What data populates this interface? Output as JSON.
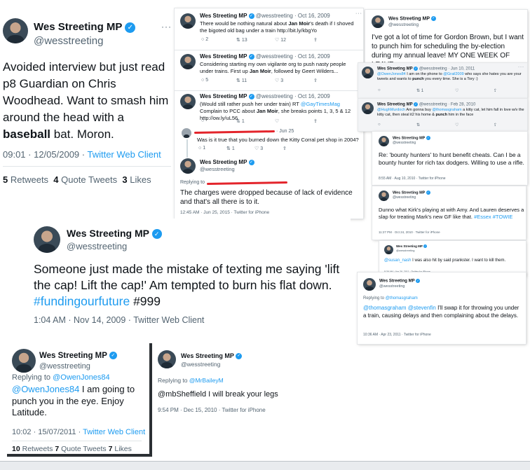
{
  "account": {
    "name": "Wes Streeting MP",
    "handle": "@wesstreeting"
  },
  "t1": {
    "text_a": "Avoided interview but just read p8 Guardian on Chris Woodhead. Want to smash him around the head with a ",
    "text_bold": "baseball",
    "text_b": " bat. Moron.",
    "time": "09:01 · 12/05/2009 · ",
    "client": "Twitter Web Client",
    "stats": [
      {
        "count": "5",
        "label": "Retweets"
      },
      {
        "count": "4",
        "label": "Quote Tweets"
      },
      {
        "count": "3",
        "label": "Likes"
      }
    ]
  },
  "t2": {
    "rows": [
      {
        "date": "· Oct 16, 2009",
        "text_a": "There would be nothing natural about ",
        "bold": "Jan Moir",
        "text_b": "'s death if I shoved the bigoted old bag under a train http://bit.ly/kbgYo",
        "counts": [
          "2",
          "13",
          "12"
        ]
      },
      {
        "date": "· Oct 16, 2009",
        "text_a": "Considering starting my own vigilante org to push nasty people under trains. First up ",
        "bold": "Jan Moir",
        "text_b": ", followed by Geert Wilders...",
        "counts": [
          "5",
          "11",
          "3"
        ]
      },
      {
        "date": "· Oct 16, 2009",
        "text_a": "(Would still rather push her under train) RT ",
        "mention": "@GayTimesMag",
        "text_b": " Complain to PCC about ",
        "bold": "Jan Moir",
        "text_c": ", she breaks points 1, 3, 5 & 12 http://ow.ly/uL56",
        "counts": [
          "",
          "1",
          ""
        ]
      }
    ],
    "reply_parent": {
      "date": "· Jun 25",
      "text": "Was is it true that you burned down the Kitty Corral pet shop in 2004?",
      "counts": [
        "1",
        "1",
        "3"
      ]
    },
    "reply": {
      "replying_to": "Replying to",
      "text": "The charges were dropped because of lack of evidence and that's all there is to it.",
      "time": "12:45 AM · Jun 25, 2015 · Twitter for iPhone"
    }
  },
  "t3": {
    "text": "I've got a lot of time for Gordon Brown, but I want to punch him for scheduling the by-election during my annual leave! MY ONE WEEK OF LEAVE",
    "row1": {
      "date": "· Jun 10, 2011",
      "mention": "@OwenJones84",
      "text_a": " I am on the phone to ",
      "mention2": "@Grail2009",
      "text_b": " who says she hates you are your tweets and wants to ",
      "bold": "punch",
      "text_c": " you every time. She is a Tory :)",
      "counts": [
        "",
        "1",
        ""
      ]
    },
    "row2": {
      "date": "· Feb 28, 2010",
      "mention": "@HughMurdoch",
      "text_a": " Am gonna buy ",
      "mention2": "@thomasgraham",
      "text_b": " a kitty cat, let him fall in love w/v the kitty cat, then steal it2 his home & ",
      "bold": "punch",
      "text_c": " him in the face"
    }
  },
  "t4": {
    "text": "Re: 'bounty hunters' to hunt benefit cheats. Can I be a bounty hunter for rich tax dodgers. Willing to use a rifle.",
    "time": "8:55 AM · Aug 10, 2010 · Twitter for iPhone"
  },
  "t5": {
    "text_a": "Dunno what Kirk's playing at with Amy. And Lauren deserves a slap for treating Mark's new GF like that. ",
    "tags": "#Essex #TOWIE",
    "time": "11:27 PM · Oct 24, 2010 · Twitter for iPhone"
  },
  "t6": {
    "mention": "@susan_nash",
    "text": " I was also hit by said prankster. I want to kill them.",
    "time": "8:39 AM · Apr 26, 2011 · Twitter for iPhone"
  },
  "t7": {
    "replying_to": "Replying to ",
    "replying_handle": "@thomasgraham",
    "mention1": "@thomasgraham",
    "mention2": "@stevenfin",
    "text": " I'll swap it for throwing you under a train, causing delays and then complaining about the delays.",
    "time": "10:36 AM · Apr 23, 2011 · Twitter for iPhone"
  },
  "t8": {
    "text_a": "Someone just made the mistake of texting me saying 'lift the cap! Lift the cap!' Am tempted to burn his flat down. ",
    "hashtag": "#fundingourfuture",
    "text_b": " #999",
    "time": "1:04 AM · Nov 14, 2009 · Twitter Web Client"
  },
  "t9": {
    "replying_to": "Replying to ",
    "replying_handle": "@OwenJones84",
    "mention": "@OwenJones84",
    "text": " I am going to punch you in the eye. Enjoy Latitude.",
    "time": "10:02 · 15/07/2011 · ",
    "client": "Twitter Web Client",
    "stats": [
      {
        "count": "10",
        "label": "Retweets"
      },
      {
        "count": "7",
        "label": "Quote Tweets"
      },
      {
        "count": "7",
        "label": "Likes"
      }
    ]
  },
  "t10": {
    "replying_to": "Replying to ",
    "replying_handle": "@MrBaileyM",
    "text": "@mbSheffield I will break your legs",
    "time": "9:54 PM · Dec 15, 2010 · Twitter for iPhone"
  },
  "icons": {
    "verified": "✓",
    "more": "···",
    "reply": "○",
    "retweet": "⇅",
    "like": "♡",
    "share": "⇪"
  },
  "colors": {
    "link": "#1d9bf0",
    "text": "#0f1419",
    "muted": "#536471",
    "redact": "#e3242b"
  }
}
